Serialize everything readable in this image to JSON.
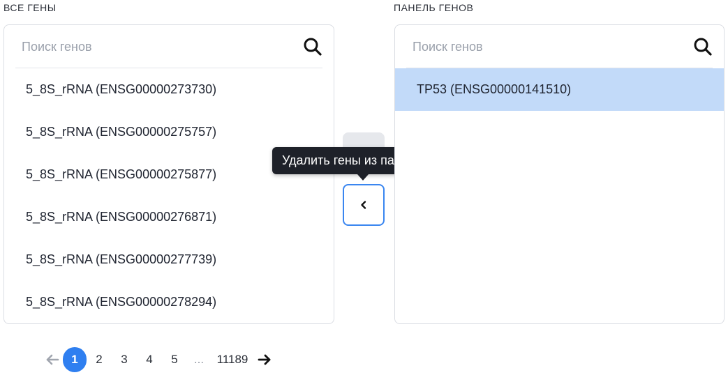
{
  "left_panel": {
    "label": "ВСЕ ГЕНЫ",
    "search_placeholder": "Поиск генов",
    "items": [
      "5_8S_rRNA (ENSG00000273730)",
      "5_8S_rRNA (ENSG00000275757)",
      "5_8S_rRNA (ENSG00000275877)",
      "5_8S_rRNA (ENSG00000276871)",
      "5_8S_rRNA (ENSG00000277739)",
      "5_8S_rRNA (ENSG00000278294)"
    ]
  },
  "right_panel": {
    "label": "ПАНЕЛЬ ГЕНОВ",
    "search_placeholder": "Поиск генов",
    "items": [
      "TP53 (ENSG00000141510)"
    ],
    "selected_index": 0
  },
  "transfer": {
    "tooltip": "Удалить гены из панели",
    "add_icon": "chevron-right-icon",
    "remove_icon": "chevron-left-icon"
  },
  "pagination": {
    "current": "1",
    "pages": [
      "1",
      "2",
      "3",
      "4",
      "5"
    ],
    "ellipsis": "...",
    "last": "11189",
    "prev_icon": "arrow-left-icon",
    "next_icon": "arrow-right-icon"
  },
  "colors": {
    "accent": "#2f7ff0",
    "selected_row": "#c2daf9",
    "tooltip_bg": "#1e2129"
  }
}
